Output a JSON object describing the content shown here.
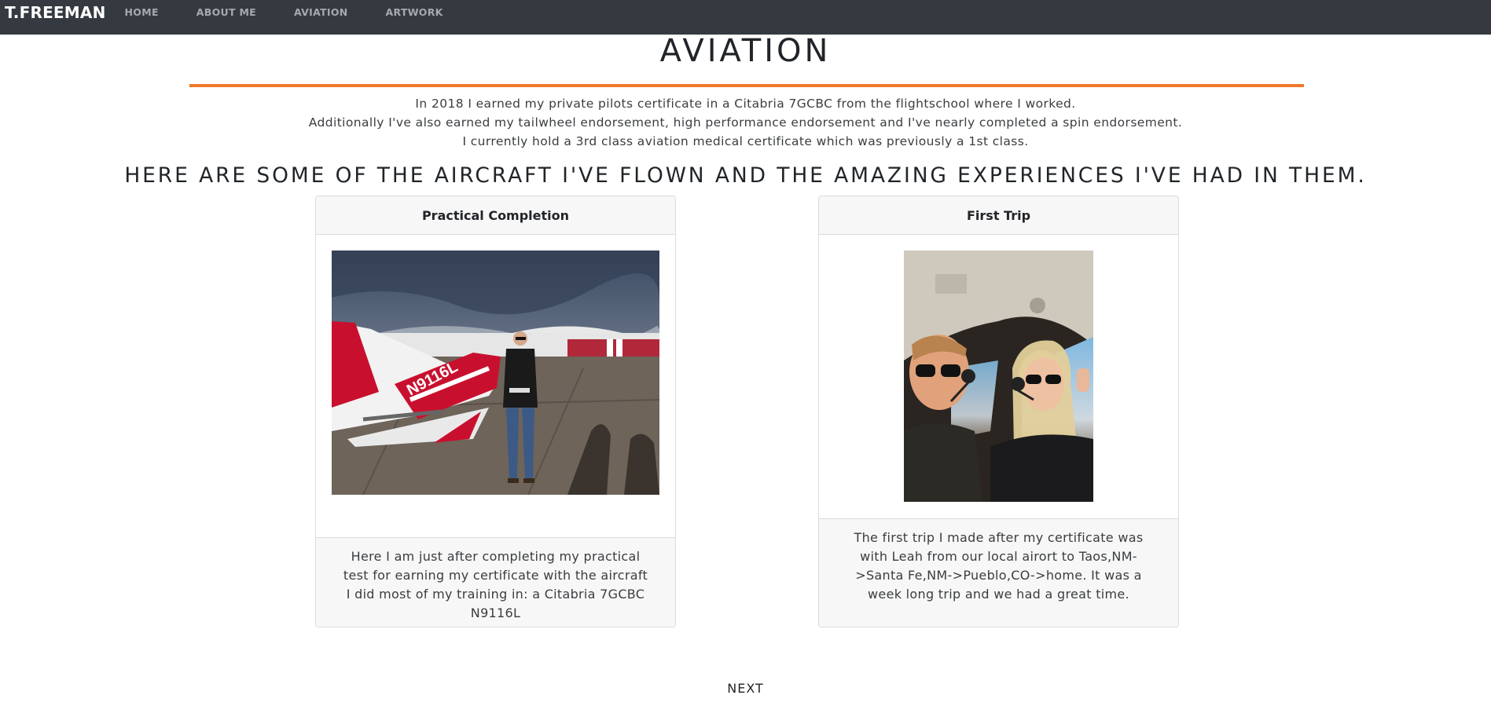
{
  "nav": {
    "brand": "T.FREEMAN",
    "links": [
      "HOME",
      "ABOUT ME",
      "AVIATION",
      "ARTWORK"
    ]
  },
  "page": {
    "title": "AVIATION",
    "intro": [
      "In 2018 I earned my private pilots certificate in a Citabria 7GCBC from the flightschool where I worked.",
      "Additionally I've also earned my tailwheel endorsement, high performance endorsement and I've nearly completed a spin endorsement.",
      "I currently hold a 3rd class aviation medical certificate which was previously a 1st class."
    ],
    "subheading": "HERE ARE SOME OF THE AIRCRAFT I'VE FLOWN AND THE AMAZING EXPERIENCES I'VE HAD IN THEM."
  },
  "cards": [
    {
      "title": "Practical Completion",
      "caption": "Here I am just after completing my practical test for earning my certificate with the aircraft I did most of my training in: a Citabria 7GCBC N9116L"
    },
    {
      "title": "First Trip",
      "caption": "The first trip I made after my certificate was with Leah from our local airort to Taos,NM->Santa Fe,NM->Pueblo,CO->home. It was a week long trip and we had a great time."
    }
  ],
  "photo_tail_number": "N9116L",
  "next_label": "NEXT",
  "colors": {
    "navbar": "#343a40",
    "accent": "#f0782a",
    "plane_red": "#c8102e"
  }
}
